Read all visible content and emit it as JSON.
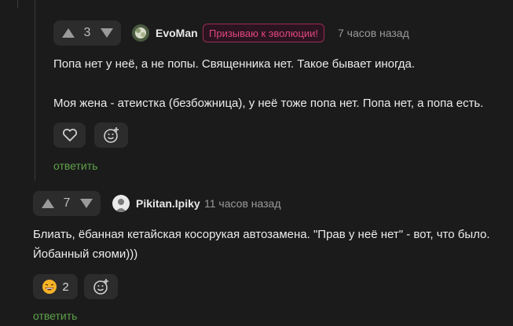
{
  "comment1": {
    "votes": "3",
    "author": "EvoMan",
    "badge": "Призываю к эволюции!",
    "time": "7 часов назад",
    "lines": [
      "Попа нет у неё, а не попы. Священника нет. Такое бывает иногда.",
      "Моя жена - атеистка (безбожница), у неё тоже попа нет. Попа нет, а попа есть."
    ],
    "reply": "ответить",
    "icons": [
      "heart-icon",
      "add-reaction-icon"
    ]
  },
  "comment2": {
    "votes": "7",
    "author": "Pikitan.Ipiky",
    "time": "11 часов назад",
    "lines": [
      "Блиать, ёбанная кетайская косорукая автозамена. \"Прав у неё нет\" - вот, что было.",
      "Йобанный сяоми)))"
    ],
    "reaction_count": "2",
    "reply": "ответить",
    "icons": [
      "laughing-emoji-icon",
      "add-reaction-icon"
    ]
  },
  "colors": {
    "background": "#1b1b1b",
    "reply": "#5fa24a",
    "badge": "#e0467e"
  }
}
